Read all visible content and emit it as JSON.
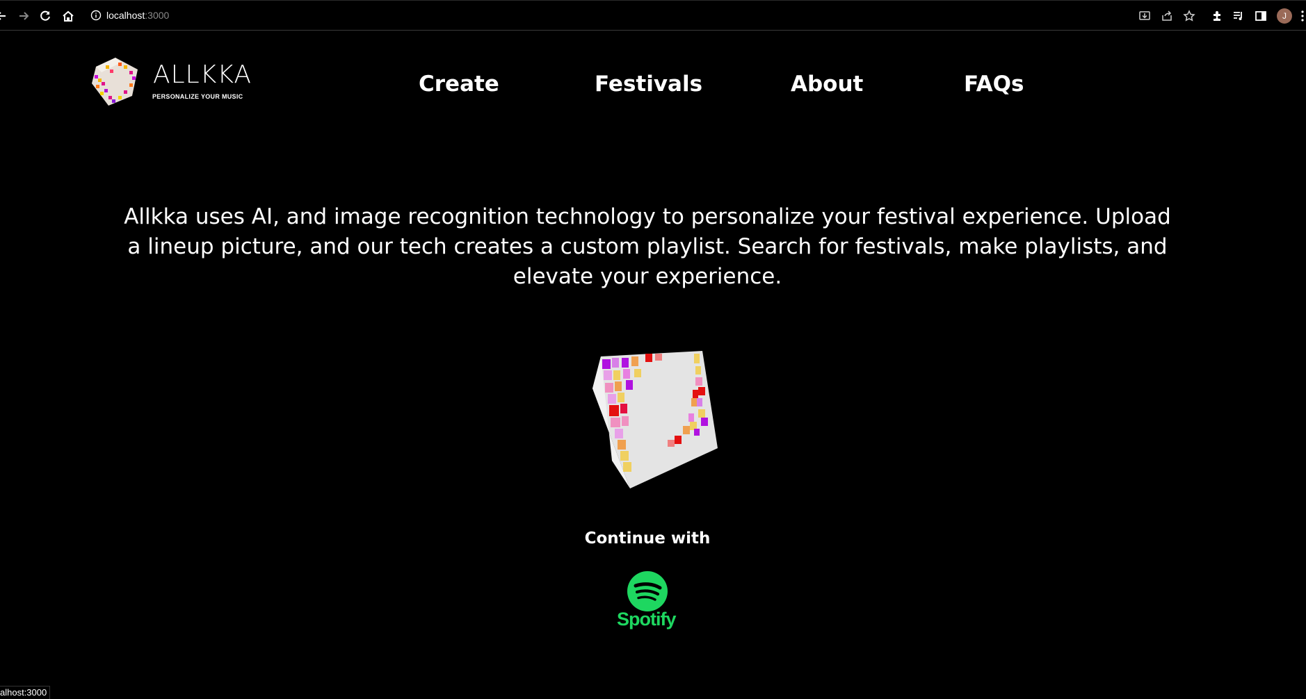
{
  "browser": {
    "url_host": "localhost",
    "url_port": ":3000",
    "profile_initial": "J",
    "status_url": "alhost:3000"
  },
  "header": {
    "logo_title": "ALLKKA",
    "logo_subtitle": "PERSONALIZE YOUR MUSIC",
    "nav": [
      {
        "label": "Create"
      },
      {
        "label": "Festivals"
      },
      {
        "label": "About"
      },
      {
        "label": "FAQs"
      }
    ]
  },
  "main": {
    "description": "Allkka uses AI, and image recognition technology to personalize your festival experience. Upload a lineup picture, and our tech creates a custom playlist. Search for festivals, make playlists, and elevate your experience.",
    "continue_label": "Continue with",
    "spotify_label": "Spotify"
  },
  "colors": {
    "background": "#000000",
    "text": "#ffffff",
    "spotify_green": "#1ed760"
  }
}
